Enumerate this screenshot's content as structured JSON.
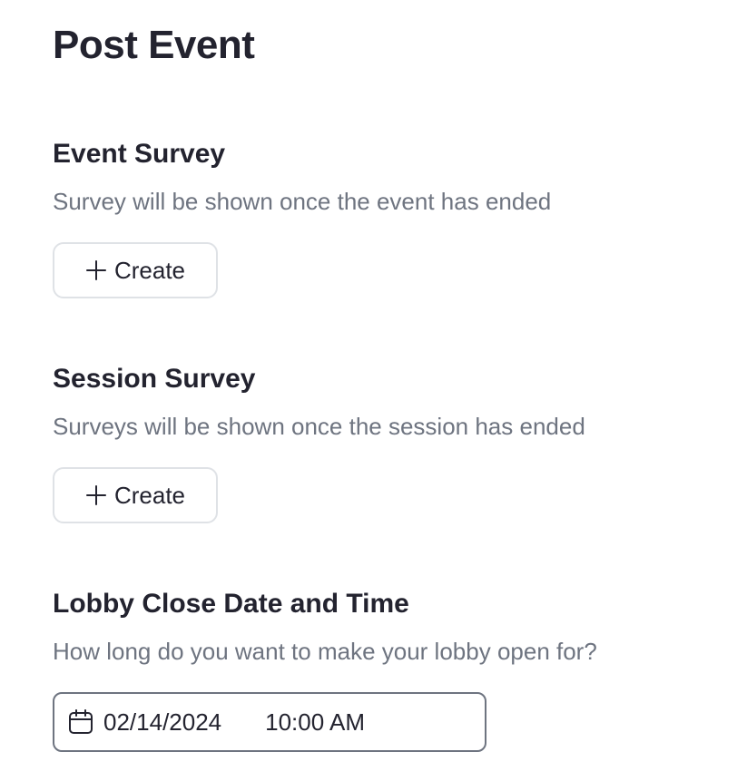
{
  "page": {
    "title": "Post Event"
  },
  "event_survey": {
    "title": "Event Survey",
    "description": "Survey will be shown once the event has ended",
    "create_label": "Create",
    "create_icon": "plus-icon"
  },
  "session_survey": {
    "title": "Session Survey",
    "description": "Surveys will be shown once the session has ended",
    "create_label": "Create",
    "create_icon": "plus-icon"
  },
  "lobby_close": {
    "title": "Lobby Close Date and Time",
    "description": "How long do you want to make your lobby open for?",
    "date": "02/14/2024",
    "time": "10:00 AM",
    "icon": "calendar-icon"
  },
  "colors": {
    "heading": "#23232f",
    "muted_text": "#6e7480",
    "button_border": "#dfe2e6",
    "field_border": "#6e7480"
  }
}
